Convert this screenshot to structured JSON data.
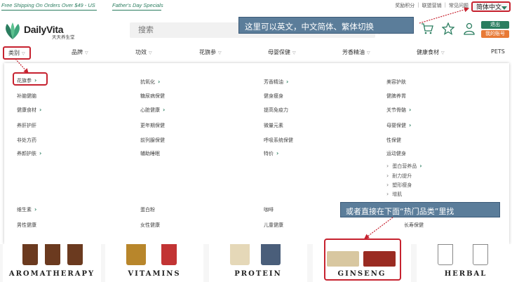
{
  "topbar": {
    "promo_shipping": "Free Shipping On Orders Over $49 - US",
    "promo_fathers_day": "Father's Day Specials",
    "links": [
      "奖励积分",
      "联盟营销",
      "常见问题"
    ],
    "language": "简体中文"
  },
  "header": {
    "logo_name": "DailyVita",
    "logo_sub": "天天养生堂",
    "search_placeholder": "搜索",
    "logout_label": "退出",
    "account_label": "我的账号"
  },
  "annotations": {
    "top_note": "这里可以英文，中文简体、繁体切换",
    "bottom_note": "或者直接在下面“热门品类”里找"
  },
  "nav": {
    "items": [
      "类别",
      "品牌",
      "功效",
      "花旗参",
      "母婴保健",
      "芳香精油",
      "健康食材",
      "PETS"
    ]
  },
  "menu": {
    "col1": [
      "花旗参",
      "补脑健脑",
      "健康食材",
      "养肝护肝",
      "非处方药",
      "养颜护肤",
      "维生素",
      "男性健康"
    ],
    "col2": [
      "抗氧化",
      "糖尿病保健",
      "心脏健康",
      "更年期保健",
      "前列腺保健",
      "辅助睡眠",
      "蛋白粉",
      "女性健康"
    ],
    "col3": [
      "芳香精油",
      "健身瘦身",
      "提高免疫力",
      "微量元素",
      "呼吸系统保健",
      "特价",
      "咖啡",
      "儿童健康"
    ],
    "col4": [
      "美容护肤",
      "健脾养胃",
      "关节骨骼",
      "母婴保健",
      "性保健",
      "运动健身",
      "蛋白营养品",
      "耐力提升",
      "塑形瘦身",
      "增肌",
      "长寿保健"
    ]
  },
  "categories": [
    "AROMATHERAPY",
    "VITAMINS",
    "PROTEIN",
    "GINSENG",
    "HERBAL"
  ],
  "colors": {
    "brand_green": "#2a7d5f",
    "accent_orange": "#e87a36",
    "highlight_red": "#c6222f",
    "annotation_blue": "#5b7d9a"
  }
}
